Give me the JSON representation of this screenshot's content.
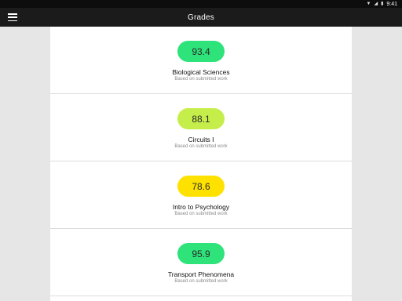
{
  "status_bar": {
    "time": "9:41",
    "icons": [
      "wifi-icon",
      "signal-icon",
      "battery-icon"
    ]
  },
  "app_bar": {
    "title": "Grades",
    "menu_icon": "hamburger-menu-icon"
  },
  "courses": [
    {
      "score": "93.4",
      "name": "Biological Sciences",
      "subtitle": "Based on submitted work",
      "color": "#2ee37a"
    },
    {
      "score": "88.1",
      "name": "Circuits I",
      "subtitle": "Based on submitted work",
      "color": "#c5ee4a"
    },
    {
      "score": "78.6",
      "name": "Intro to Psychology",
      "subtitle": "Based on submitted work",
      "color": "#ffe100"
    },
    {
      "score": "95.9",
      "name": "Transport Phenomena",
      "subtitle": "Based on submitted work",
      "color": "#2ee37a"
    }
  ]
}
